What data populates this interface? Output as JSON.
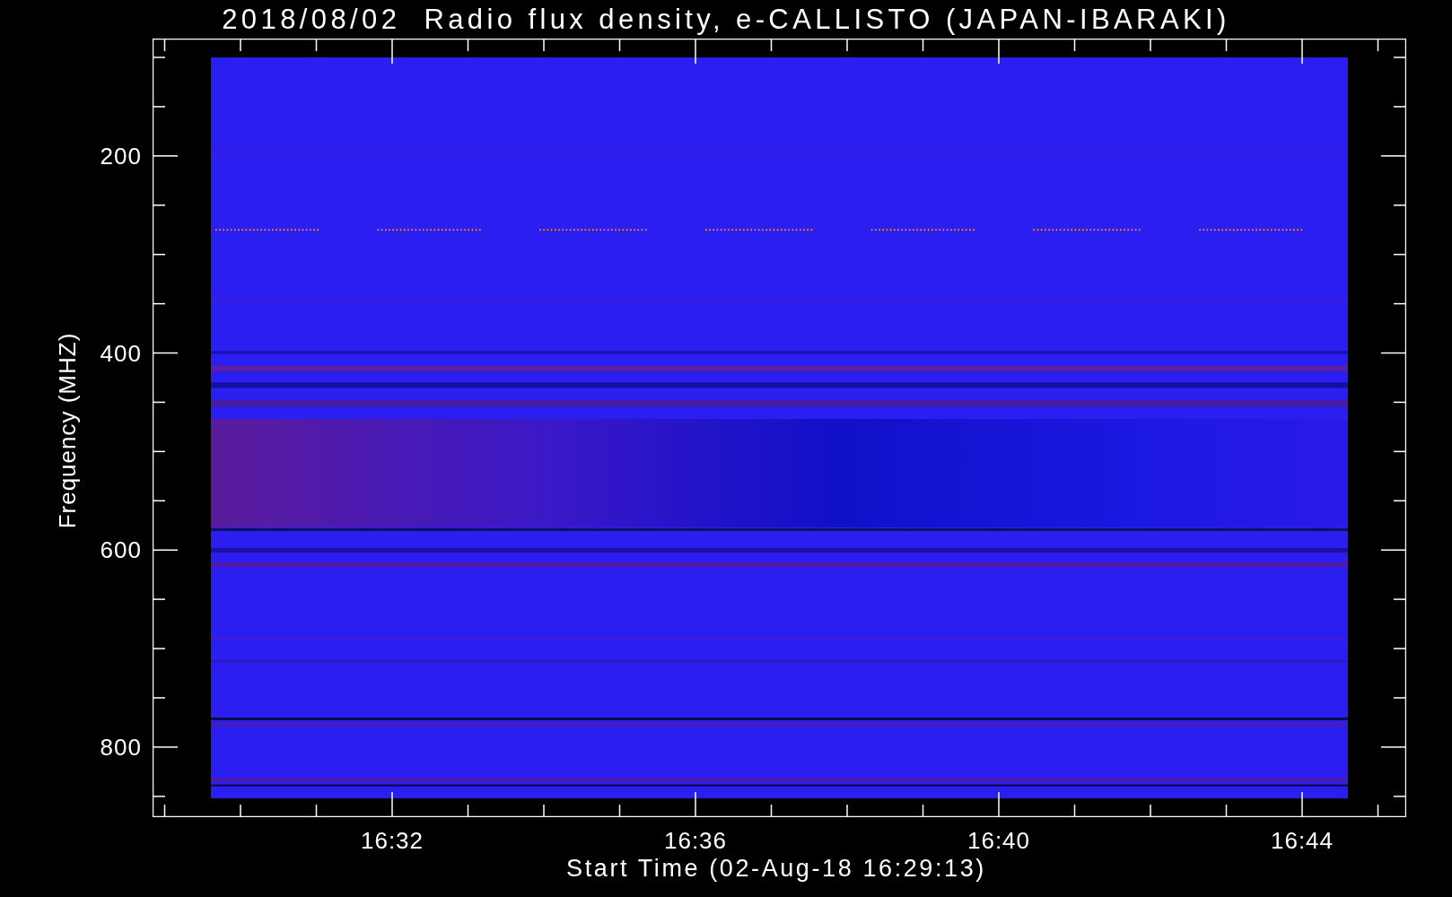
{
  "title": "2018/08/02  Radio flux density, e-CALLISTO (JAPAN-IBARAKI)",
  "y_axis": {
    "label": "Frequency (MHZ)",
    "ticks": [
      "200",
      "400",
      "600",
      "800"
    ]
  },
  "x_axis": {
    "label": "Start Time (02-Aug-18 16:29:13)",
    "ticks": [
      "16:32",
      "16:36",
      "16:40",
      "16:44"
    ]
  }
}
